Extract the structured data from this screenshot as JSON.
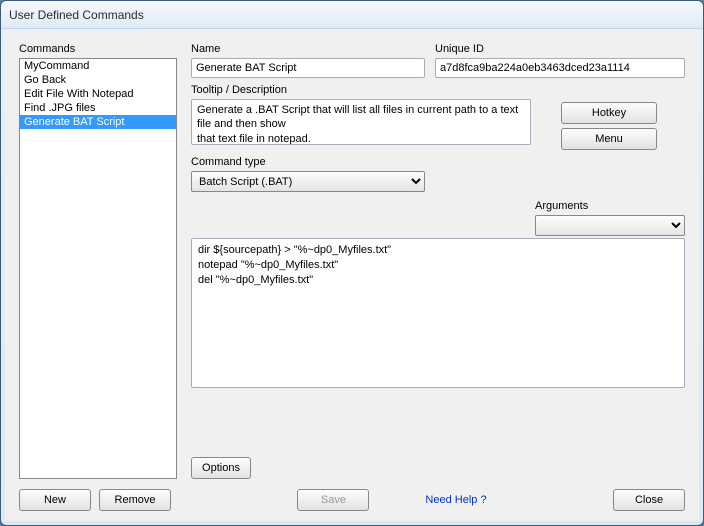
{
  "window": {
    "title": "User Defined Commands"
  },
  "left": {
    "label": "Commands",
    "items": [
      "MyCommand",
      "Go Back",
      "Edit File With Notepad",
      "Find .JPG files",
      "Generate BAT Script"
    ],
    "selected_index": 4
  },
  "labels": {
    "name": "Name",
    "unique_id": "Unique ID",
    "tooltip": "Tooltip / Description",
    "command_type": "Command type",
    "arguments": "Arguments"
  },
  "values": {
    "name": "Generate BAT Script",
    "unique_id": "a7d8fca9ba224a0eb3463dced23a1114",
    "tooltip": "Generate a .BAT Script that will list all files in current path to a text file and then show\nthat text file in notepad.",
    "command_type": "Batch Script (.BAT)",
    "arguments": "",
    "script": "dir ${sourcepath} > \"%~dp0_Myfiles.txt\"\nnotepad \"%~dp0_Myfiles.txt\"\ndel \"%~dp0_Myfiles.txt\""
  },
  "buttons": {
    "hotkey": "Hotkey",
    "menu": "Menu",
    "options": "Options",
    "new": "New",
    "remove": "Remove",
    "save": "Save",
    "close": "Close",
    "help": "Need Help ?"
  }
}
